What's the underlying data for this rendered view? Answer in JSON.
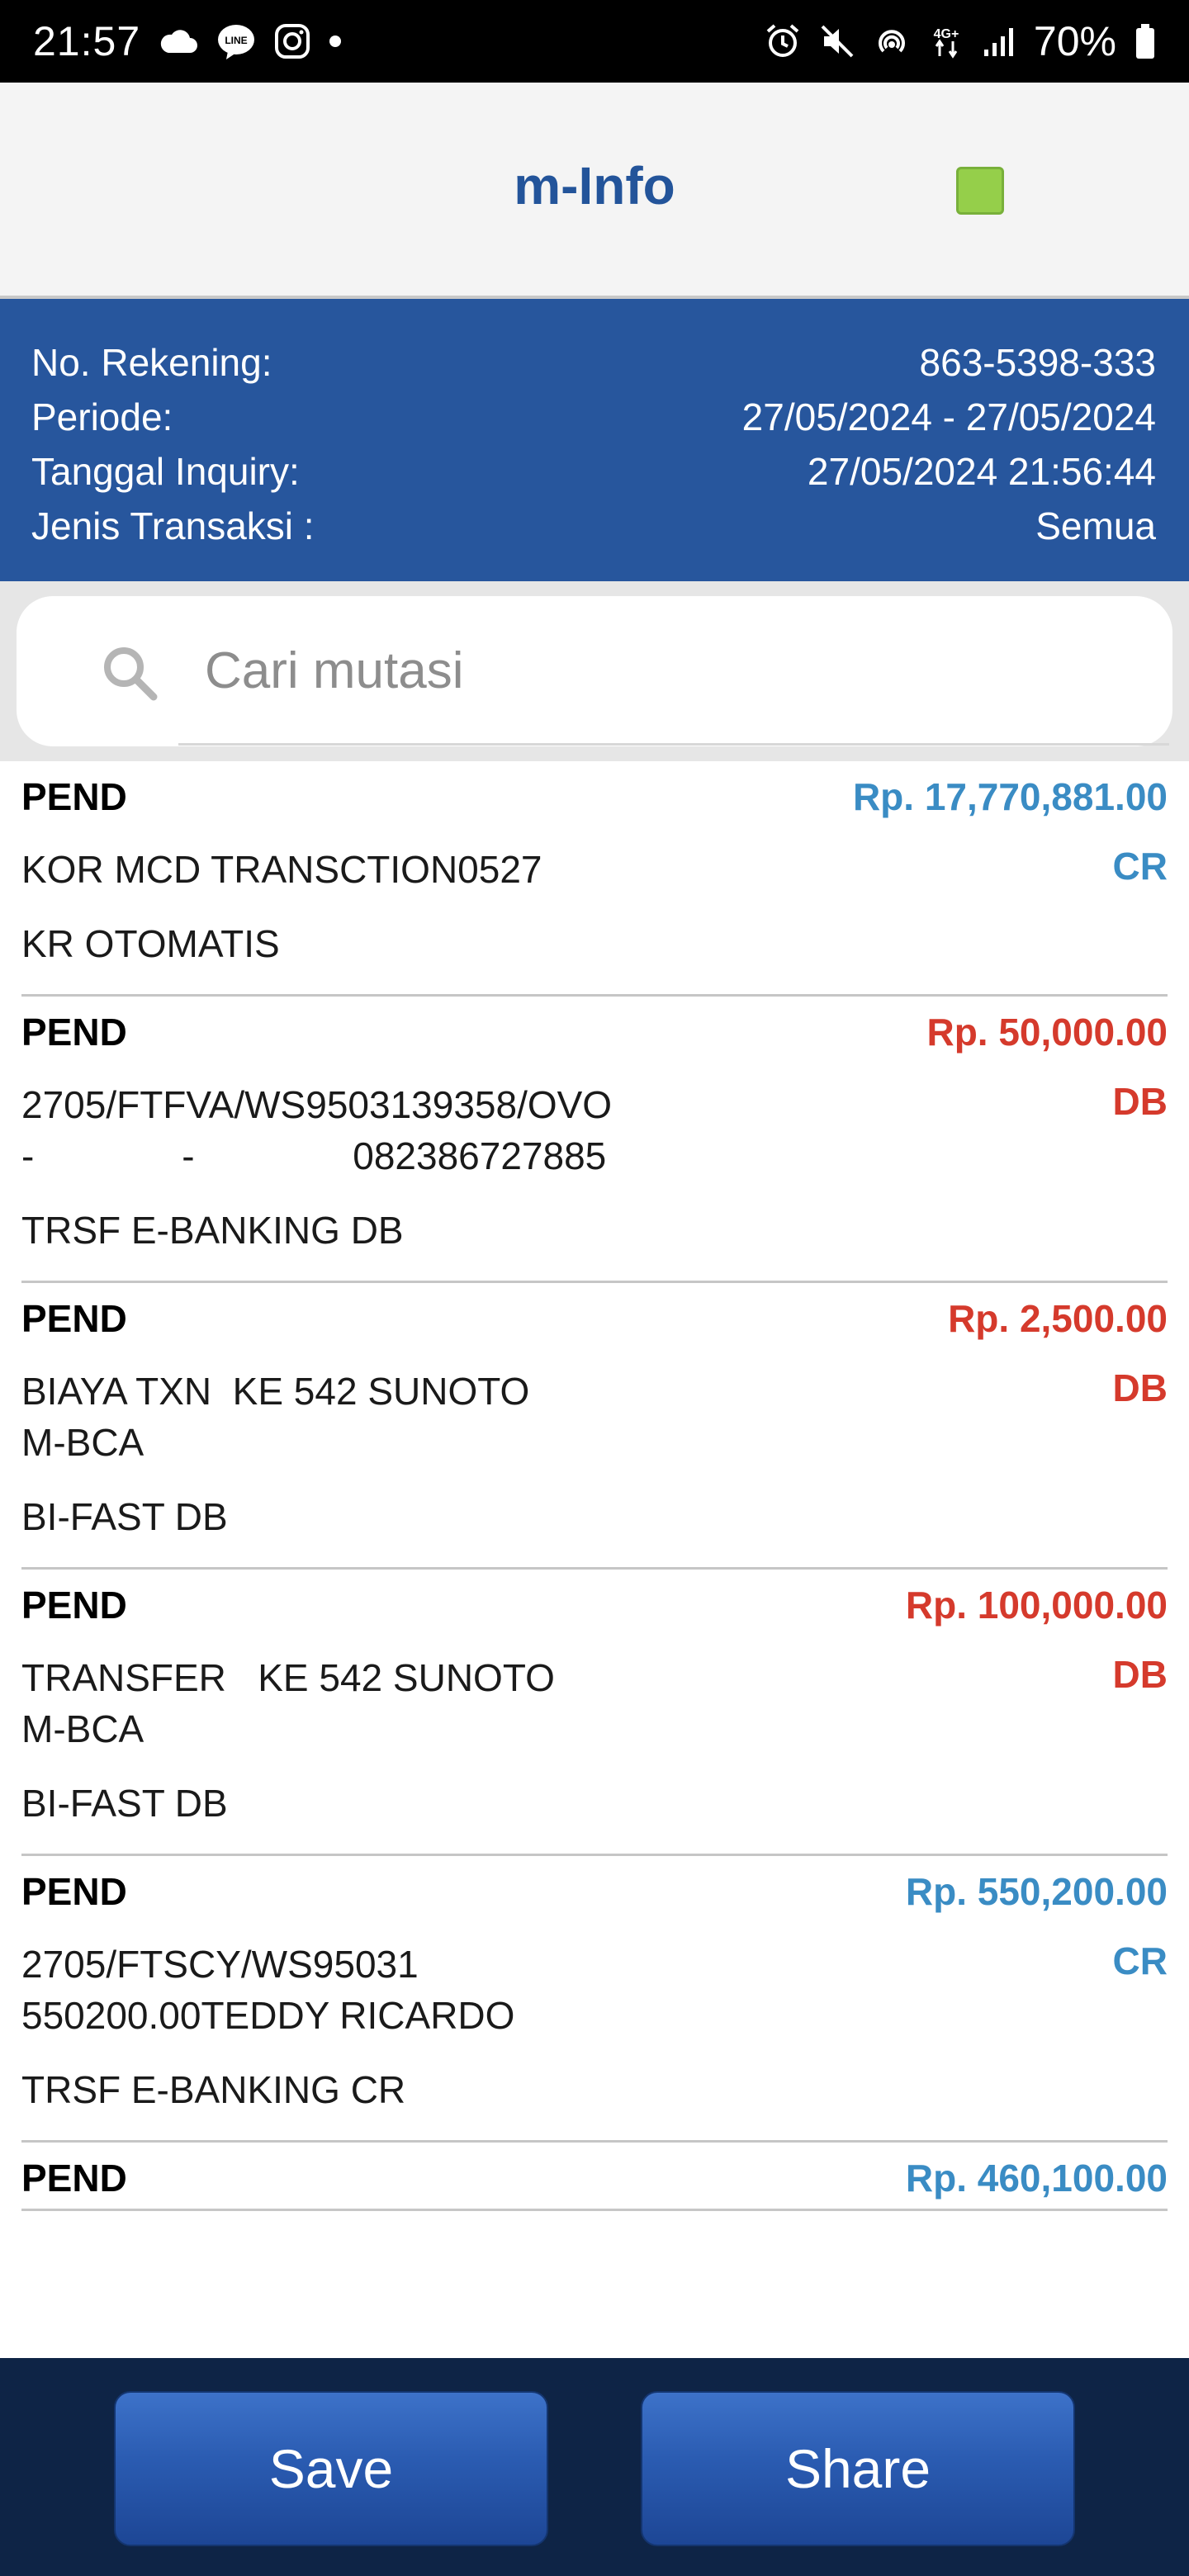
{
  "status_bar": {
    "time": "21:57",
    "battery": "70%",
    "network": "4G+",
    "left_icons": [
      "cloud-icon",
      "line-icon",
      "instagram-icon",
      "dot-icon"
    ],
    "right_icons": [
      "alarm-icon",
      "mute-icon",
      "hotspot-icon",
      "network-icon",
      "signal-icon",
      "battery-icon"
    ]
  },
  "header": {
    "title": "m-Info",
    "indicator_color": "#95cf4a"
  },
  "account": {
    "rows": [
      {
        "label": "No. Rekening:",
        "value": "863-5398-333"
      },
      {
        "label": "Periode:",
        "value": "27/05/2024 - 27/05/2024"
      },
      {
        "label": "Tanggal Inquiry:",
        "value": "27/05/2024 21:56:44"
      },
      {
        "label": "Jenis Transaksi :",
        "value": "Semua"
      }
    ]
  },
  "search": {
    "placeholder": "Cari mutasi",
    "value": ""
  },
  "transactions": [
    {
      "status": "PEND",
      "amount": "Rp. 17,770,881.00",
      "desc": "KOR MCD TRANSCTION0527",
      "type": "CR",
      "category": "KR OTOMATIS"
    },
    {
      "status": "PEND",
      "amount": "Rp. 50,000.00",
      "desc": "2705/FTFVA/WS9503139358/OVO\n-              -               082386727885",
      "type": "DB",
      "category": "TRSF E-BANKING DB"
    },
    {
      "status": "PEND",
      "amount": "Rp. 2,500.00",
      "desc": "BIAYA TXN  KE 542 SUNOTO\nM-BCA",
      "type": "DB",
      "category": "BI-FAST DB"
    },
    {
      "status": "PEND",
      "amount": "Rp. 100,000.00",
      "desc": "TRANSFER   KE 542 SUNOTO\nM-BCA",
      "type": "DB",
      "category": "BI-FAST DB"
    },
    {
      "status": "PEND",
      "amount": "Rp. 550,200.00",
      "desc": "2705/FTSCY/WS95031\n550200.00TEDDY RICARDO",
      "type": "CR",
      "category": "TRSF E-BANKING CR"
    },
    {
      "status": "PEND",
      "amount": "Rp. 460,100.00",
      "desc": "",
      "type": "",
      "category": ""
    }
  ],
  "actions": {
    "save_label": "Save",
    "share_label": "Share"
  },
  "colors": {
    "brand_blue": "#27569d",
    "credit": "#3a8cc4",
    "debit": "#d53a2c",
    "bottom_bar": "#0e2446"
  }
}
